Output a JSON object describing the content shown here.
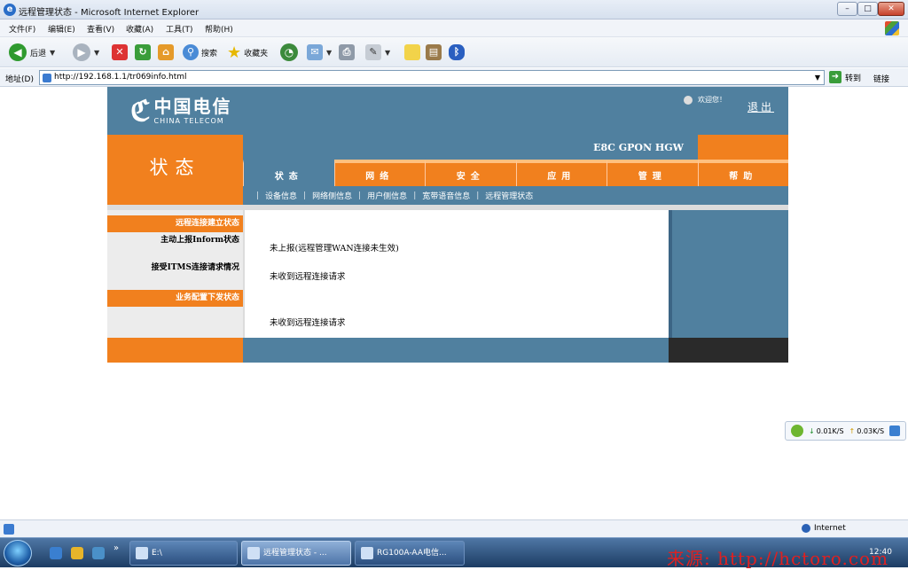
{
  "window": {
    "title": "远程管理状态 - Microsoft Internet Explorer",
    "min": "–",
    "max": "□",
    "close": "✕"
  },
  "menu": [
    "文件(F)",
    "编辑(E)",
    "查看(V)",
    "收藏(A)",
    "工具(T)",
    "帮助(H)"
  ],
  "toolbar": {
    "back": "后退",
    "search": "搜索",
    "favorites": "收藏夹"
  },
  "address": {
    "label": "地址(D)",
    "url": "http://192.168.1.1/tr069info.html",
    "go": "转到",
    "links": "链接"
  },
  "router": {
    "logo_cn": "中国电信",
    "logo_en": "CHINA TELECOM",
    "welcome": "欢迎您！",
    "logout": "退出",
    "section": "状态",
    "model": "E8C GPON HGW",
    "tabs": [
      "状态",
      "网络",
      "安全",
      "应用",
      "管理",
      "帮助"
    ],
    "subnav": [
      "设备信息",
      "网络侧信息",
      "用户侧信息",
      "宽带语音信息",
      "远程管理状态"
    ],
    "sidebar": {
      "head1": "远程连接建立状态",
      "item1": "主动上报Inform状态",
      "item2": "接受ITMS连接请求情况",
      "head2": "业务配置下发状态"
    },
    "values": {
      "inform": "未上报(远程管理WAN连接未生效)",
      "itms": "未收到远程连接请求",
      "service": "未收到远程连接请求"
    }
  },
  "speed": {
    "down": "0.01K/S",
    "up": "0.03K/S"
  },
  "status": {
    "zone": "Internet"
  },
  "taskbar": {
    "tasks": [
      "E:\\",
      "远程管理状态 - ...",
      "RG100A-AA电信..."
    ],
    "clock": "12:40",
    "watermark": "来源: http://hctoro.com"
  }
}
